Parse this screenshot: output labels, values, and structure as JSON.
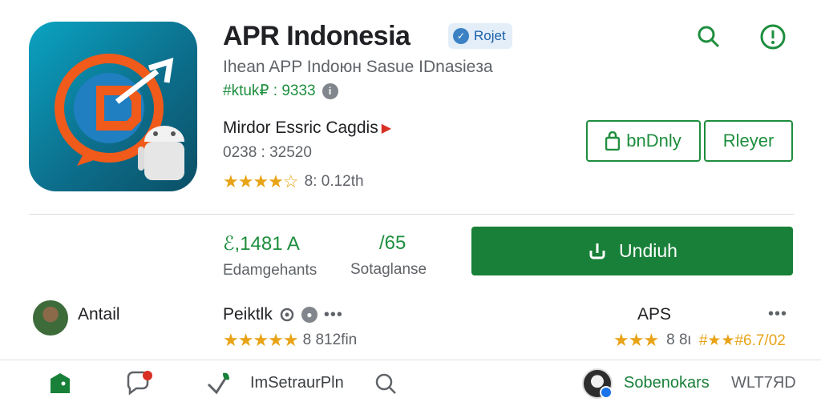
{
  "header": {
    "title": "APR Indonesia",
    "badge_label": "Rojet",
    "subtitle": "Ihean APP Indoюн Sasue IDnasieзa",
    "developer": "#ktuk₽ : 9333",
    "info_icon": "info-circle-icon",
    "search_icon": "search-icon",
    "alert_icon": "alert-circle-icon"
  },
  "details": {
    "category": "Mirdor Essric Cagdis",
    "version": "0238 : 32520",
    "rating_stars": "★★★★☆",
    "rating_text": "8: 0.12th"
  },
  "buttons": {
    "primary_outline": "bnDnly",
    "secondary_outline": "Rleyer",
    "install": "Undiuh"
  },
  "stats": [
    {
      "value": "ℰ,1481 A",
      "label": "Edamgehants"
    },
    {
      "value": "/65",
      "label": "Sotaglanse"
    }
  ],
  "review": {
    "reviewer": "Antail",
    "title": "Peiktlk",
    "dots": "•••",
    "stars": "★★★★★",
    "text": "8 812fin",
    "right_label": "APS",
    "more": "•••",
    "right_stars": "★★★",
    "right_num": "8 8ι",
    "right_text": "#★★#6.7/02"
  },
  "bottom_nav": {
    "search_text": "ImSetraurPln",
    "profile_link": "Sobenokars",
    "profile_code": "WLT7ЯD"
  },
  "colors": {
    "accent": "#1e8e3e",
    "install": "#188038",
    "star": "#e8a317"
  }
}
